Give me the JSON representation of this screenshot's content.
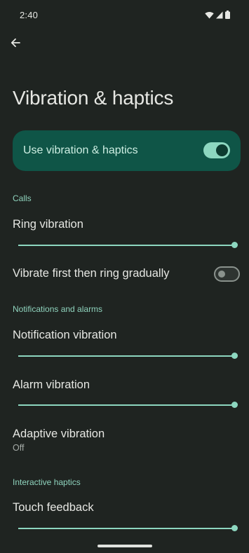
{
  "status_bar": {
    "time": "2:40",
    "icons": [
      "wifi-icon",
      "cell-signal-icon",
      "battery-icon"
    ]
  },
  "header": {
    "back_icon": "arrow-back-icon",
    "title": "Vibration & haptics"
  },
  "master_toggle": {
    "label": "Use vibration & haptics",
    "on": true
  },
  "sections": {
    "calls": {
      "header": "Calls",
      "ring_vibration": {
        "title": "Ring vibration",
        "level": 1.0
      },
      "vibrate_first": {
        "title": "Vibrate first then ring gradually",
        "on": false
      }
    },
    "notifications": {
      "header": "Notifications and alarms",
      "notification_vibration": {
        "title": "Notification vibration",
        "level": 1.0
      },
      "alarm_vibration": {
        "title": "Alarm vibration",
        "level": 1.0
      },
      "adaptive_vibration": {
        "title": "Adaptive vibration",
        "summary": "Off"
      }
    },
    "interactive": {
      "header": "Interactive haptics",
      "touch_feedback": {
        "title": "Touch feedback",
        "level": 1.0
      }
    }
  },
  "colors": {
    "background": "#1f2421",
    "accent": "#8dd7c0",
    "card": "#0f5547",
    "section_header": "#8fd3bd"
  }
}
